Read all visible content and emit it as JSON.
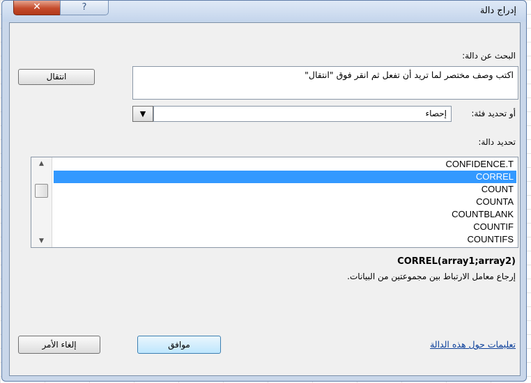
{
  "window": {
    "title": "إدراج دالة",
    "close_glyph": "✕",
    "help_glyph": "?"
  },
  "search": {
    "label": "البحث عن دالة:",
    "value": "اكتب وصف مختصر لما تريد أن تفعل ثم انقر فوق \"انتقال\"",
    "go_button": "انتقال"
  },
  "category": {
    "label": "أو تحديد فئة:",
    "selected": "إحصاء",
    "arrow_glyph": "▼"
  },
  "function_list": {
    "label": "تحديد دالة:",
    "items": [
      "CONFIDENCE.T",
      "CORREL",
      "COUNT",
      "COUNTA",
      "COUNTBLANK",
      "COUNTIF",
      "COUNTIFS"
    ],
    "selected_index": 1,
    "scroll_up_glyph": "▲",
    "scroll_down_glyph": "▼"
  },
  "details": {
    "signature": "CORREL(array1;array2)",
    "description": "إرجاع معامل الارتباط بين مجموعتين من البيانات."
  },
  "footer": {
    "help_link": "تعليمات حول هذه الدالة",
    "ok_button": "موافق",
    "cancel_button": "إلغاء الأمر"
  },
  "colors": {
    "selection": "#3399ff",
    "close_button": "#c44b2c",
    "link": "#0b3f9a"
  }
}
